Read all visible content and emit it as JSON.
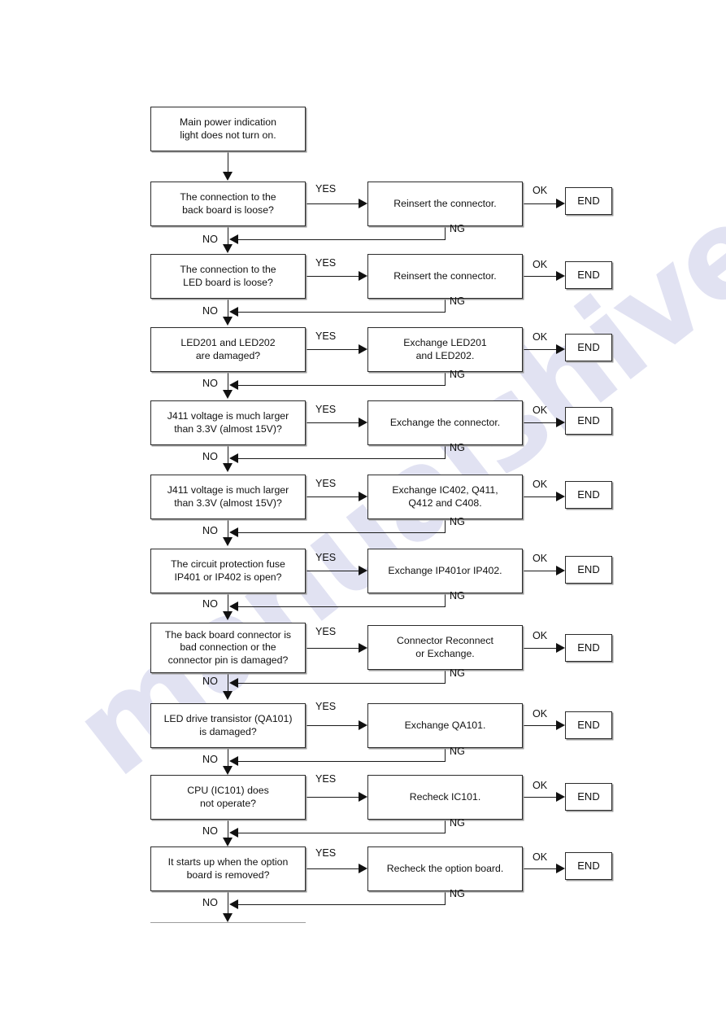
{
  "diagram": {
    "title": "Main power indication light does not turn on troubleshooting flowchart",
    "watermark_text": "manualshive.com",
    "watermark_color": "#c9cbe8",
    "line_color": "#1a1a1a",
    "box_border_color": "#2b2b2b",
    "start": {
      "label": "Main power indication\nlight does not turn on."
    },
    "edge_labels": {
      "yes": "YES",
      "no": "NO",
      "ok": "OK",
      "ng": "NG"
    },
    "end_label": "END",
    "rows": [
      {
        "id": "row-1",
        "question": "The connection to the\nback board is loose?",
        "action": "Reinsert the connector.",
        "result": "END",
        "yes": "YES",
        "no": "NO",
        "ok": "OK",
        "ng": "NG"
      },
      {
        "id": "row-2",
        "question": "The connection to the\nLED board is loose?",
        "action": "Reinsert the connector.",
        "result": "END",
        "yes": "YES",
        "no": "NO",
        "ok": "OK",
        "ng": "NG"
      },
      {
        "id": "row-3",
        "question": "LED201 and LED202\nare damaged?",
        "action": "Exchange LED201\nand LED202.",
        "result": "END",
        "yes": "YES",
        "no": "NO",
        "ok": "OK",
        "ng": "NG"
      },
      {
        "id": "row-4",
        "question": "J411 voltage is much larger\nthan 3.3V (almost 15V)?",
        "action": "Exchange the connector.",
        "result": "END",
        "yes": "YES",
        "no": "NO",
        "ok": "OK",
        "ng": "NG"
      },
      {
        "id": "row-5",
        "question": "J411 voltage is much larger\nthan 3.3V (almost 15V)?",
        "action": "Exchange IC402, Q411,\nQ412 and C408.",
        "result": "END",
        "yes": "YES",
        "no": "NO",
        "ok": "OK",
        "ng": "NG"
      },
      {
        "id": "row-6",
        "question": "The circuit protection fuse\nIP401 or IP402 is open?",
        "action": "Exchange IP401or IP402.",
        "result": "END",
        "yes": "YES",
        "no": "NO",
        "ok": "OK",
        "ng": "NG"
      },
      {
        "id": "row-7",
        "question": "The back board connector is\nbad connection or the\nconnector pin is damaged?",
        "action": "Connector Reconnect\nor Exchange.",
        "result": "END",
        "yes": "YES",
        "no": "NO",
        "ok": "OK",
        "ng": "NG"
      },
      {
        "id": "row-8",
        "question": "LED drive transistor (QA101)\nis damaged?",
        "action": "Exchange QA101.",
        "result": "END",
        "yes": "YES",
        "no": "NO",
        "ok": "OK",
        "ng": "NG"
      },
      {
        "id": "row-9",
        "question": "CPU (IC101) does\nnot operate?",
        "action": "Recheck IC101.",
        "result": "END",
        "yes": "YES",
        "no": "NO",
        "ok": "OK",
        "ng": "NG"
      },
      {
        "id": "row-10",
        "question": "It starts up when the option\nboard is removed?",
        "action": "Recheck the option board.",
        "result": "END",
        "yes": "YES",
        "no": "NO",
        "ok": "OK",
        "ng": "NG"
      }
    ]
  }
}
